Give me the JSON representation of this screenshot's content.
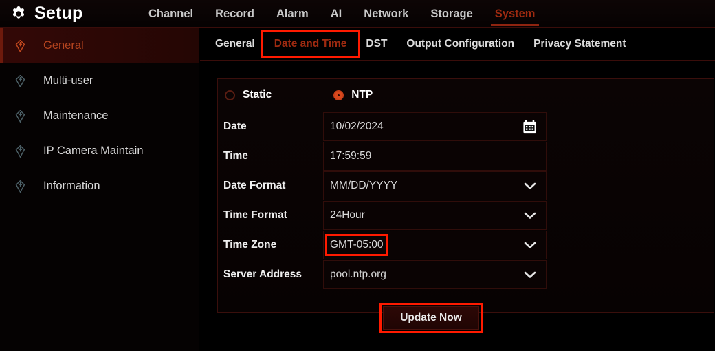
{
  "header": {
    "brand_title": "Setup",
    "brand_icon": "gear-icon",
    "nav": [
      {
        "label": "Channel",
        "active": false
      },
      {
        "label": "Record",
        "active": false
      },
      {
        "label": "Alarm",
        "active": false
      },
      {
        "label": "AI",
        "active": false
      },
      {
        "label": "Network",
        "active": false
      },
      {
        "label": "Storage",
        "active": false
      },
      {
        "label": "System",
        "active": true
      }
    ]
  },
  "sidebar": {
    "items": [
      {
        "label": "General",
        "icon": "pin-icon",
        "active": true
      },
      {
        "label": "Multi-user",
        "icon": "pin-icon",
        "active": false
      },
      {
        "label": "Maintenance",
        "icon": "pin-icon",
        "active": false
      },
      {
        "label": "IP Camera Maintain",
        "icon": "pin-icon",
        "active": false
      },
      {
        "label": "Information",
        "icon": "pin-icon",
        "active": false
      }
    ]
  },
  "subtabs": [
    {
      "label": "General",
      "active": false,
      "highlighted": false
    },
    {
      "label": "Date and Time",
      "active": true,
      "highlighted": true
    },
    {
      "label": "DST",
      "active": false,
      "highlighted": false
    },
    {
      "label": "Output Configuration",
      "active": false,
      "highlighted": false
    },
    {
      "label": "Privacy Statement",
      "active": false,
      "highlighted": false
    }
  ],
  "form": {
    "mode_options": [
      {
        "label": "Static",
        "selected": false
      },
      {
        "label": "NTP",
        "selected": true
      }
    ],
    "fields": [
      {
        "label": "Date",
        "value": "10/02/2024",
        "icon": "calendar-icon",
        "highlighted": false
      },
      {
        "label": "Time",
        "value": "17:59:59",
        "icon": "none",
        "highlighted": false
      },
      {
        "label": "Date Format",
        "value": "MM/DD/YYYY",
        "icon": "chevron-down-icon",
        "highlighted": false
      },
      {
        "label": "Time Format",
        "value": "24Hour",
        "icon": "chevron-down-icon",
        "highlighted": false
      },
      {
        "label": "Time Zone",
        "value": "GMT-05:00",
        "icon": "chevron-down-icon",
        "highlighted": true
      },
      {
        "label": "Server Address",
        "value": "pool.ntp.org",
        "icon": "chevron-down-icon",
        "highlighted": false
      }
    ],
    "update_button": "Update Now"
  },
  "colors": {
    "accent_red": "#9e2a10",
    "annotation_red": "#ff1a00",
    "radio_on": "#d9481d",
    "background": "#000000",
    "text": "#e8e8e8"
  }
}
